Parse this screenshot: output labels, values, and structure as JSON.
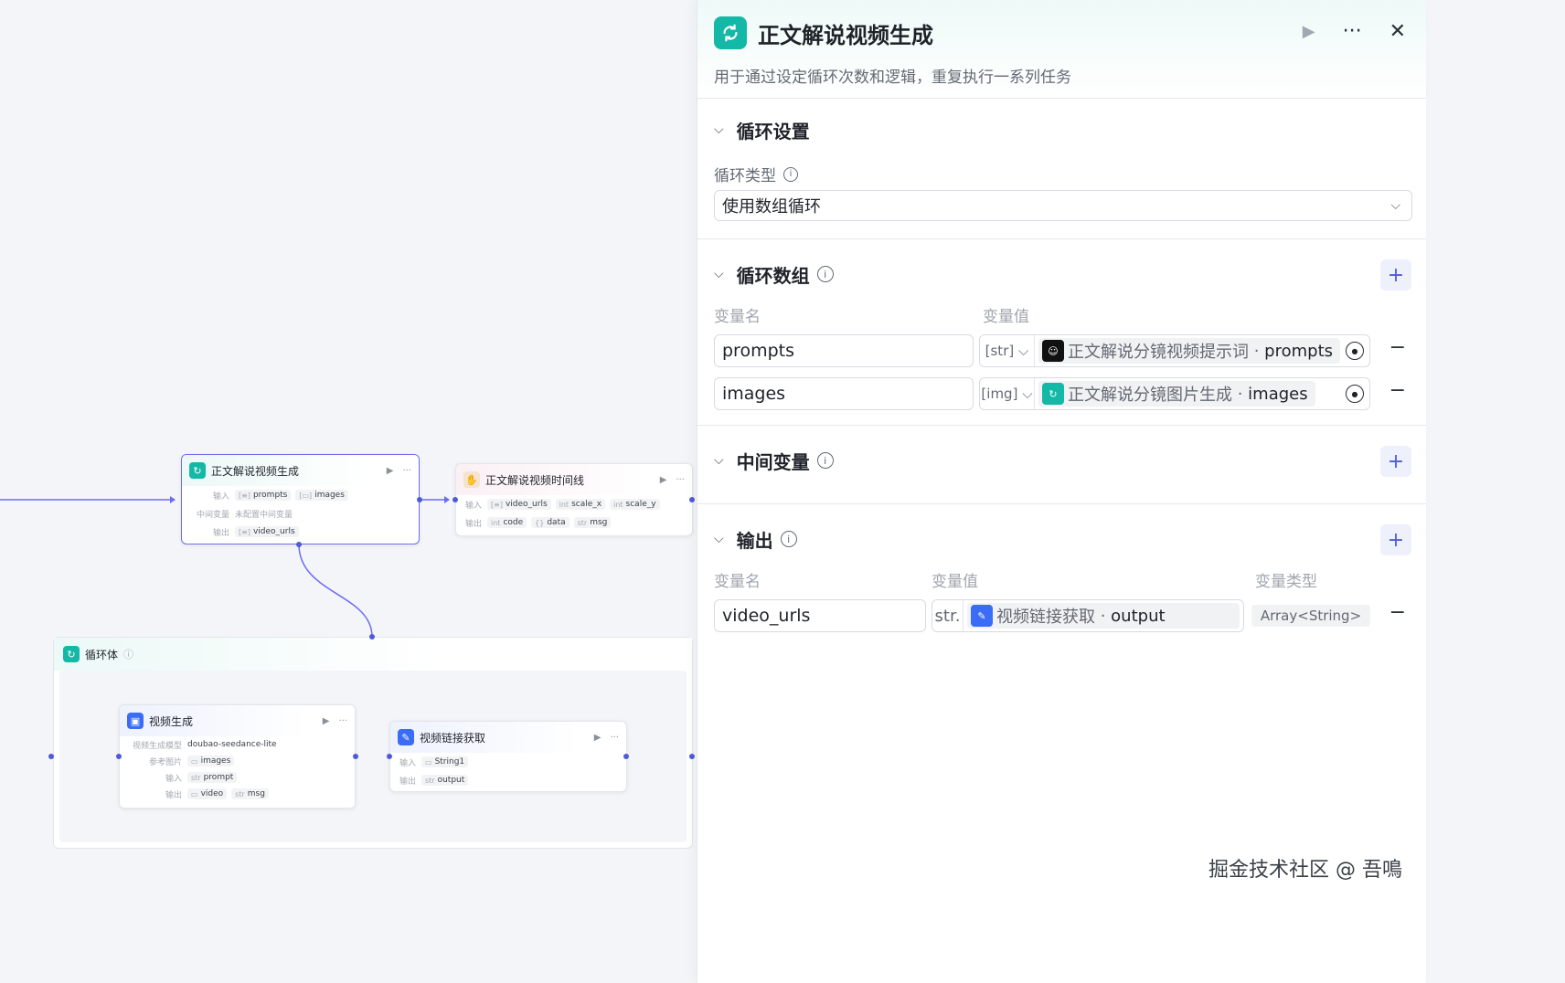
{
  "canvas": {
    "node_main": {
      "title": "正文解说视频生成",
      "input_label": "输入",
      "inputs": [
        "prompts",
        "images"
      ],
      "mid_label": "中间变量",
      "mid_value": "未配置中间变量",
      "output_label": "输出",
      "output": "video_urls"
    },
    "node_timeline": {
      "title": "正文解说视频时间线",
      "input_label": "输入",
      "inputs": [
        "video_urls",
        "scale_x",
        "scale_y"
      ],
      "output_label": "输出",
      "outputs": [
        "code",
        "data",
        "msg"
      ]
    },
    "loop_body": {
      "title": "循环体"
    },
    "node_video": {
      "title": "视频生成",
      "model_label": "视频生成模型",
      "model": "doubao-seedance-lite",
      "ref_label": "参考图片",
      "ref": "images",
      "input_label": "输入",
      "input": "prompt",
      "output_label": "输出",
      "outputs": [
        "video",
        "msg"
      ]
    },
    "node_link": {
      "title": "视频链接获取",
      "input_label": "输入",
      "input": "String1",
      "output_label": "输出",
      "output": "output"
    }
  },
  "panel": {
    "title": "正文解说视频生成",
    "description": "用于通过设定循环次数和逻辑，重复执行一系列任务",
    "loop_settings": {
      "heading": "循环设置",
      "type_label": "循环类型",
      "type_value": "使用数组循环"
    },
    "loop_array": {
      "heading": "循环数组",
      "col_name": "变量名",
      "col_value": "变量值",
      "rows": [
        {
          "name": "prompts",
          "type": "[str]",
          "source": "正文解说分镜视频提示词",
          "field": "prompts"
        },
        {
          "name": "images",
          "type": "[img]",
          "source": "正文解说分镜图片生成",
          "field": "images"
        }
      ]
    },
    "mid_vars": {
      "heading": "中间变量"
    },
    "output": {
      "heading": "输出",
      "col_name": "变量名",
      "col_value": "变量值",
      "col_type": "变量类型",
      "row": {
        "name": "video_urls",
        "type": "str.",
        "source": "视频链接获取",
        "field": "output",
        "var_type": "Array<String>"
      }
    }
  },
  "watermark": "掘金技术社区 @ 吾鳴",
  "colors": {
    "accent": "#4e5bd6",
    "teal": "#14b8a6"
  }
}
